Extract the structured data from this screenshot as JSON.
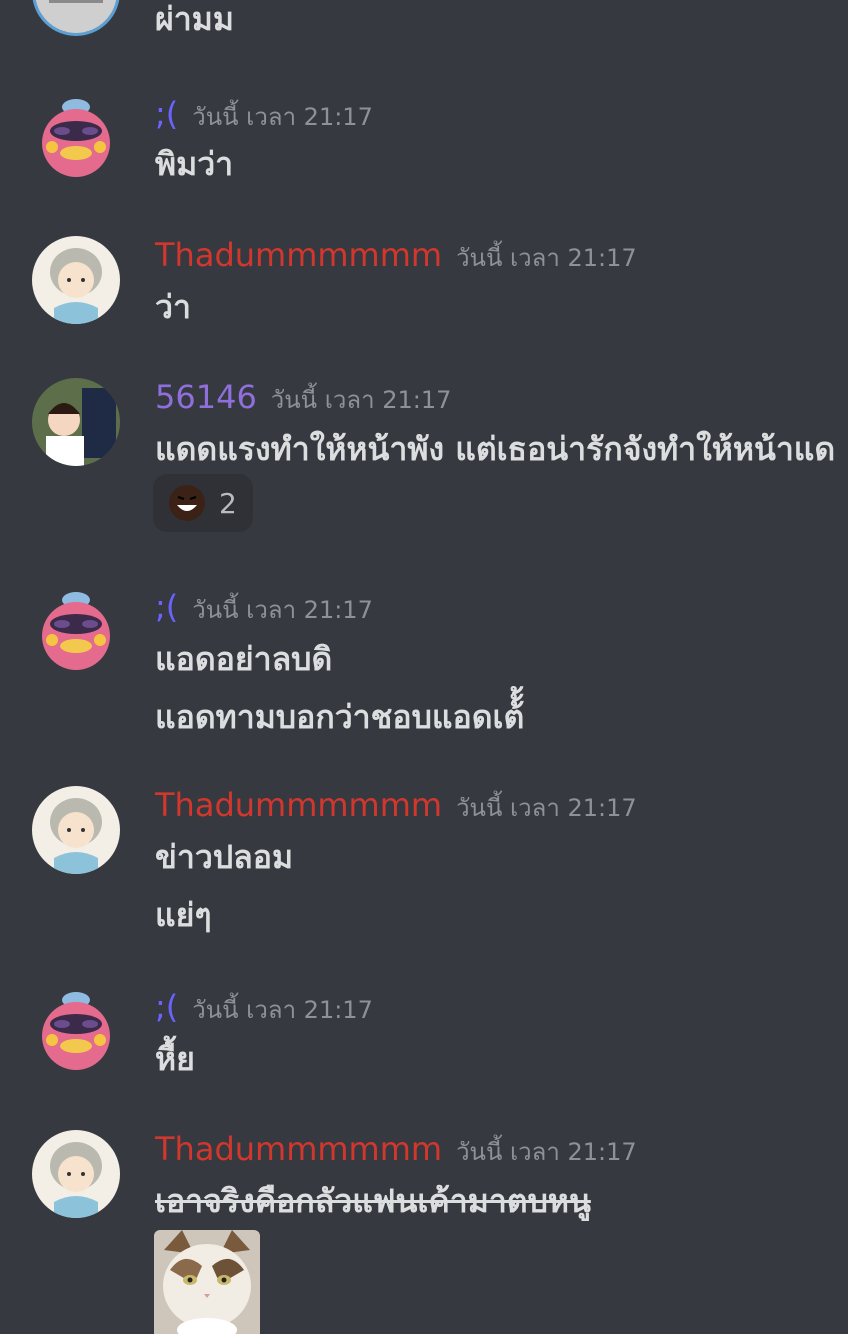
{
  "colors": {
    "background": "#36393f",
    "red_user": "#d2372e",
    "purple_user": "#8f6fdb",
    "blue_user": "#6c63ff",
    "timestamp": "#8e9297",
    "text": "#dcddde"
  },
  "messages": [
    {
      "lines": [
        "ผ่ามม"
      ]
    },
    {
      "username": ";(",
      "timestamp": "วันนี้ เวลา 21:17",
      "lines": [
        "พิมว่า"
      ]
    },
    {
      "username": "Thadummmmmm",
      "timestamp": "วันนี้ เวลา 21:17",
      "lines": [
        "ว่า"
      ]
    },
    {
      "username": "56146",
      "timestamp": "วันนี้ เวลา 21:17",
      "lines": [
        "แดดแรงทำให้หน้าพัง แต่เธอน่ารักจังทำให้หน้าแด"
      ],
      "reaction": {
        "emoji": "laughing-face-emoji",
        "count": "2"
      }
    },
    {
      "username": ";(",
      "timestamp": "วันนี้ เวลา 21:17",
      "lines": [
        "แอดอย่าลบดิ",
        "แอดทามบอกว่าชอบแอดเต้้้"
      ]
    },
    {
      "username": "Thadummmmmm",
      "timestamp": "วันนี้ เวลา 21:17",
      "lines": [
        "ข่าวปลอม",
        "แย่ๆ"
      ]
    },
    {
      "username": ";(",
      "timestamp": "วันนี้ เวลา 21:17",
      "lines": [
        "หื้ย"
      ]
    },
    {
      "username": "Thadummmmmm",
      "timestamp": "วันนี้ เวลา 21:17",
      "lines": [
        "เอาจริงคือกลัวแฟนเค้ามาตบหนู"
      ],
      "attachment": "cat-image"
    }
  ]
}
